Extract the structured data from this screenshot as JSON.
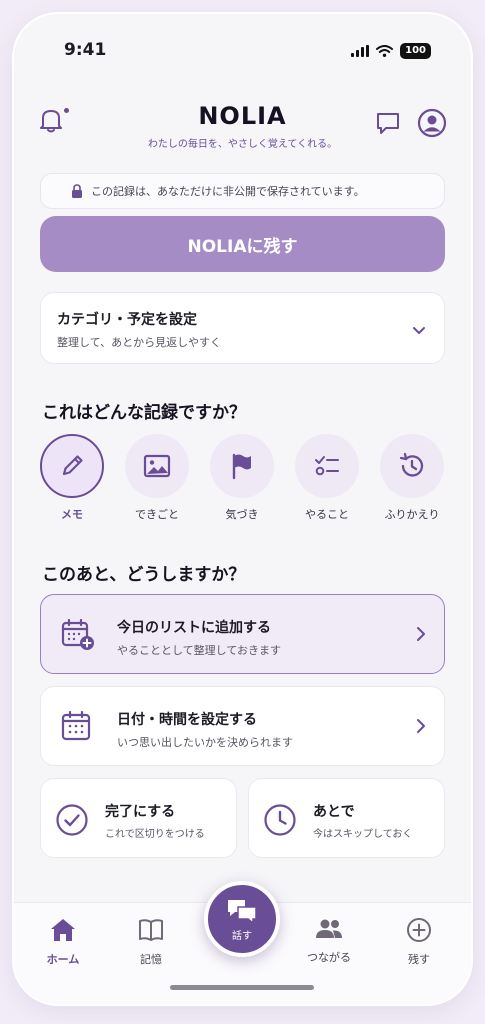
{
  "status_bar": {
    "time": "9:41",
    "battery": "100"
  },
  "header": {
    "brand": "NOLIA",
    "tagline": "わたしの毎日を、やさしく覚えてくれる。"
  },
  "privacy_note": "この記録は、あなただけに非公開で保存されています。",
  "cta_label": "NOLIAに残す",
  "category": {
    "title": "カテゴリ・予定を設定",
    "subtitle": "整理して、あとから見返しやすく"
  },
  "record_type": {
    "title": "これはどんな記録ですか？",
    "options": [
      {
        "label": "メモ",
        "icon": "pencil-icon",
        "selected": true
      },
      {
        "label": "できごと",
        "icon": "image-icon",
        "selected": false
      },
      {
        "label": "気づき",
        "icon": "flag-icon",
        "selected": false
      },
      {
        "label": "やること",
        "icon": "checklist-icon",
        "selected": false
      },
      {
        "label": "ふりかえり",
        "icon": "history-icon",
        "selected": false
      }
    ]
  },
  "next_action": {
    "title": "このあと、どうしますか？",
    "add_today": {
      "title": "今日のリストに追加する",
      "subtitle": "やることとして整理しておきます"
    },
    "set_datetime": {
      "title": "日付・時間を設定する",
      "subtitle": "いつ思い出したいかを決められます"
    },
    "complete": {
      "title": "完了にする",
      "subtitle": "これで区切りをつける"
    },
    "later": {
      "title": "あとで",
      "subtitle": "今はスキップしておく"
    }
  },
  "tabbar": {
    "home": "ホーム",
    "memory": "記憶",
    "talk": "話す",
    "connect": "つながる",
    "save": "残す",
    "active": "home"
  },
  "colors": {
    "accent": "#6a4d97",
    "cta_bg": "#a58cc4",
    "highlight_bg": "#f1ebf8"
  }
}
